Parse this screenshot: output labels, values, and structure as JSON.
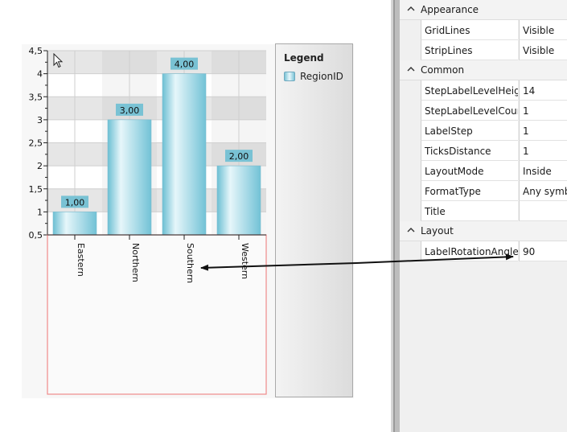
{
  "chart_data": {
    "type": "bar",
    "categories": [
      "Eastern",
      "Northern",
      "Southern",
      "Western"
    ],
    "series": [
      {
        "name": "RegionID",
        "values": [
          1,
          3,
          4,
          2
        ]
      }
    ],
    "data_labels": [
      "1,00",
      "3,00",
      "4,00",
      "2,00"
    ],
    "ylim": [
      0.5,
      4.5
    ],
    "y_ticks": [
      "0,5",
      "1",
      "1,5",
      "2",
      "2,5",
      "3",
      "3,5",
      "4",
      "4,5"
    ],
    "x_label_rotation": 90,
    "grid": true,
    "strip_lines": true,
    "legend_position": "right",
    "bar_color": "#8fd0e0"
  },
  "legend": {
    "title": "Legend",
    "item": "RegionID"
  },
  "properties": {
    "categories": [
      {
        "name": "Appearance",
        "rows": [
          {
            "name": "GridLines",
            "value": "Visible"
          },
          {
            "name": "StripLines",
            "value": "Visible"
          }
        ]
      },
      {
        "name": "Common",
        "rows": [
          {
            "name": "StepLabelLevelHeight",
            "value": "14"
          },
          {
            "name": "StepLabelLevelCount",
            "value": "1"
          },
          {
            "name": "LabelStep",
            "value": "1"
          },
          {
            "name": "TicksDistance",
            "value": "1"
          },
          {
            "name": "LayoutMode",
            "value": "Inside"
          },
          {
            "name": "FormatType",
            "value": "Any symbo"
          },
          {
            "name": "Title",
            "value": ""
          }
        ]
      },
      {
        "name": "Layout",
        "rows": [
          {
            "name": "LabelRotationAngle",
            "value": "90"
          }
        ]
      }
    ]
  }
}
